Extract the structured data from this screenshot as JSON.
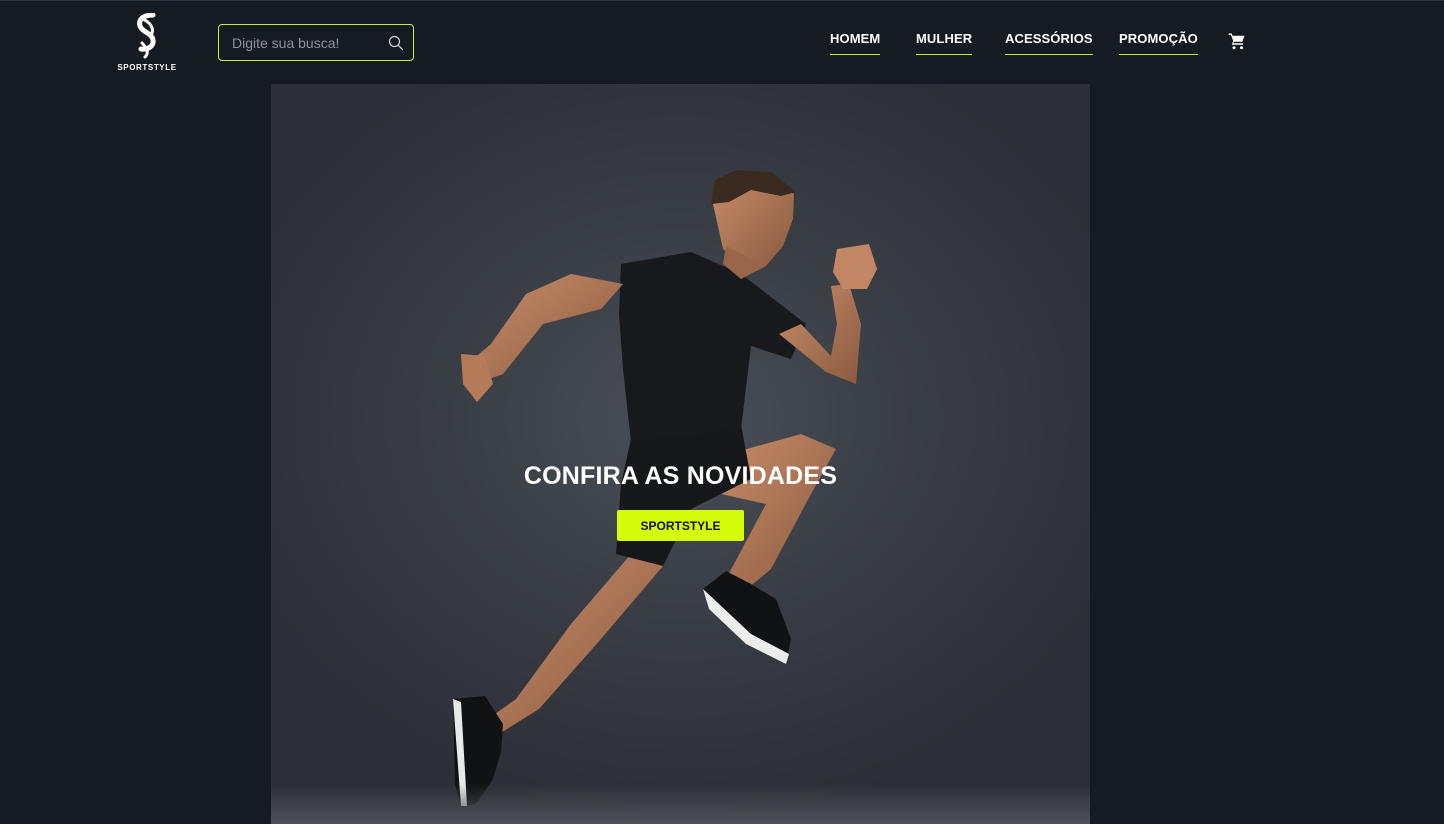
{
  "brand": {
    "name": "SPORTSTYLE",
    "logo_icon": "s-logo-icon"
  },
  "search": {
    "placeholder": "Digite sua busca!",
    "value": "",
    "icon": "search-icon"
  },
  "nav": {
    "items": [
      {
        "label": "HOMEM"
      },
      {
        "label": "MULHER"
      },
      {
        "label": "ACESSÓRIOS"
      },
      {
        "label": "PROMOÇÃO"
      }
    ],
    "cart_icon": "cart-icon"
  },
  "hero": {
    "title": "CONFIRA AS NOVIDADES",
    "button_label": "SPORTSTYLE",
    "image": "running-athlete-photo"
  },
  "colors": {
    "accent": "#d4fc0b",
    "border_accent": "#c9ec3a",
    "background": "#161a21",
    "text": "#ffffff"
  }
}
